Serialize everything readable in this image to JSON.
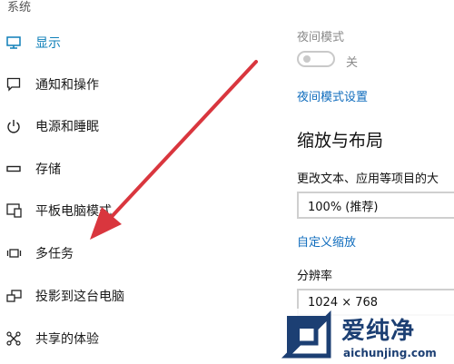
{
  "sidebar": {
    "header": "系统",
    "items": [
      {
        "label": "显示",
        "icon": "monitor-icon",
        "active": true
      },
      {
        "label": "通知和操作",
        "icon": "message-icon"
      },
      {
        "label": "电源和睡眠",
        "icon": "power-icon"
      },
      {
        "label": "存储",
        "icon": "storage-icon"
      },
      {
        "label": "平板电脑模式",
        "icon": "tablet-mode-icon"
      },
      {
        "label": "多任务",
        "icon": "multitasking-icon"
      },
      {
        "label": "投影到这台电脑",
        "icon": "projection-icon"
      },
      {
        "label": "共享的体验",
        "icon": "shared-experience-icon"
      }
    ]
  },
  "content": {
    "night_mode_label": "夜间模式",
    "night_mode_state": "关",
    "night_mode_settings_link": "夜间模式设置",
    "scale_layout_title": "缩放与布局",
    "text_size_label": "更改文本、应用等项目的大",
    "scale_value": "100% (推荐)",
    "custom_scale_link": "自定义缩放",
    "resolution_label": "分辨率",
    "resolution_value": "1024 × 768"
  },
  "watermark": {
    "brand": "爱纯净",
    "url": "aichunjing.com"
  },
  "colors": {
    "accent": "#0e7fb8",
    "link": "#0f6cbd",
    "arrow": "#d9363e",
    "watermark": "#1c3f73"
  }
}
